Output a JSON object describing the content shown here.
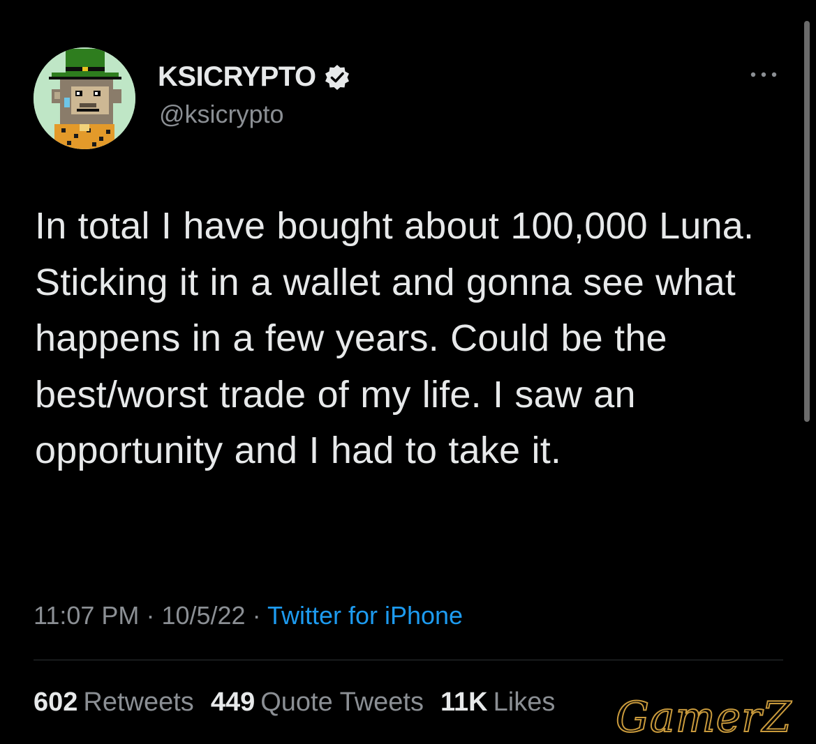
{
  "tweet": {
    "author": {
      "display_name": "KSICRYPTO",
      "handle": "@ksicrypto",
      "verified": true,
      "avatar_icon": "pixel-ape-avatar"
    },
    "more_icon": "more-dots-icon",
    "text": "In total I have bought about 100,000 Luna. Sticking it in a wallet and gonna see what happens in a few years. Could be the best/worst trade of my life. I saw an opportunity and I had to take it.",
    "time": "11:07 PM",
    "separator": "·",
    "date": "10/5/22",
    "source": "Twitter for iPhone",
    "stats": {
      "retweets_count": "602",
      "retweets_label": "Retweets",
      "quotes_count": "449",
      "quotes_label": "Quote Tweets",
      "likes_count": "11K",
      "likes_label": "Likes"
    }
  },
  "watermark": "GamerZ",
  "colors": {
    "background": "#000000",
    "primary_text": "#e7e9ea",
    "secondary_text": "#8b8f94",
    "link": "#1d9bf0",
    "watermark": "#c99a3c"
  }
}
